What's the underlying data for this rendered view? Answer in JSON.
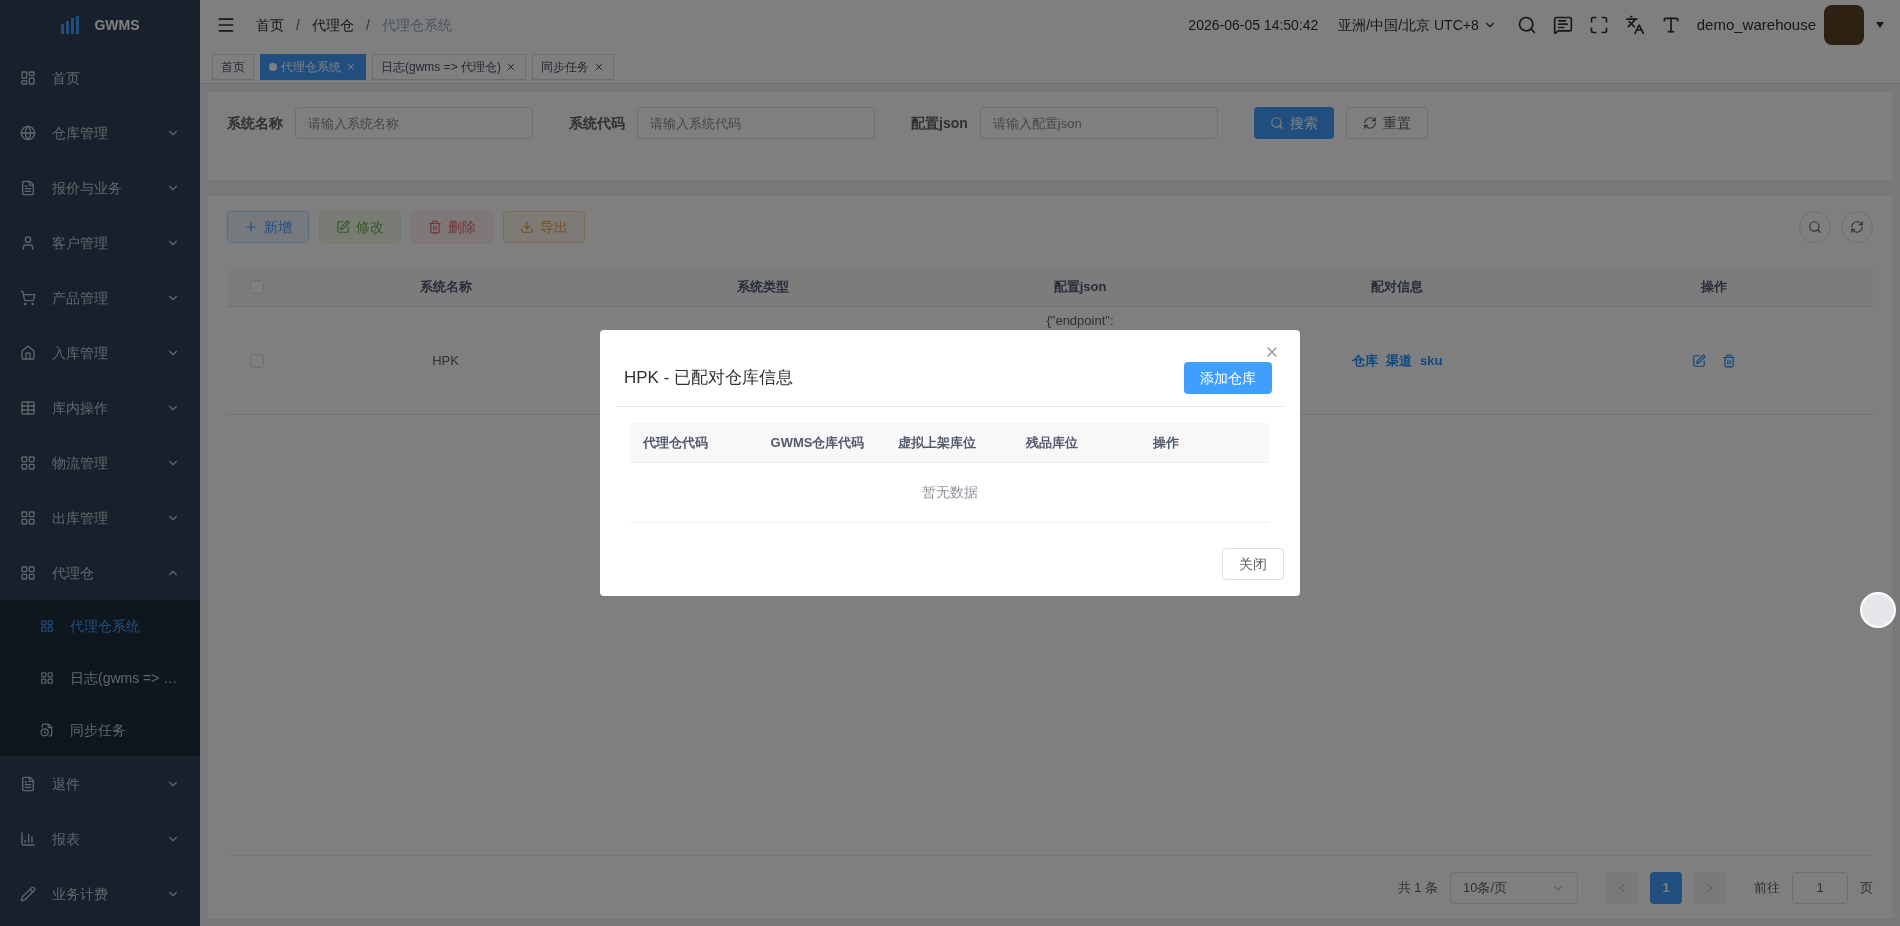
{
  "sidebar": {
    "logo": "GWMS",
    "items": [
      {
        "label": "首页"
      },
      {
        "label": "仓库管理",
        "expanded": false
      },
      {
        "label": "报价与业务",
        "expanded": false
      },
      {
        "label": "客户管理",
        "expanded": false
      },
      {
        "label": "产品管理",
        "expanded": false
      },
      {
        "label": "入库管理",
        "expanded": false
      },
      {
        "label": "库内操作",
        "expanded": false
      },
      {
        "label": "物流管理",
        "expanded": false
      },
      {
        "label": "出库管理",
        "expanded": false
      },
      {
        "label": "代理仓",
        "expanded": true,
        "children": [
          {
            "label": "代理仓系统",
            "selected": true
          },
          {
            "label": "日志(gwms => …",
            "selected": false
          },
          {
            "label": "同步任务",
            "selected": false
          }
        ]
      },
      {
        "label": "退件",
        "expanded": false
      },
      {
        "label": "报表",
        "expanded": false
      },
      {
        "label": "业务计费",
        "expanded": false
      }
    ]
  },
  "header": {
    "breadcrumb": [
      "首页",
      "代理仓",
      "代理仓系统"
    ],
    "breadcrumb_separator": "/",
    "datetime": "2026-06-05 14:50:42",
    "timezone": "亚洲/中国/北京 UTC+8",
    "username": "demo_warehouse"
  },
  "tags": [
    {
      "label": "首页",
      "selected": false,
      "closable": false
    },
    {
      "label": "代理仓系统",
      "selected": true,
      "closable": true
    },
    {
      "label": "日志(gwms => 代理仓)",
      "selected": false,
      "closable": true
    },
    {
      "label": "同步任务",
      "selected": false,
      "closable": true
    }
  ],
  "search_form": {
    "fields": [
      {
        "label": "系统名称",
        "placeholder": "请输入系统名称"
      },
      {
        "label": "系统代码",
        "placeholder": "请输入系统代码"
      },
      {
        "label": "配置json",
        "placeholder": "请输入配置json"
      }
    ],
    "search_button": "搜索",
    "reset_button": "重置"
  },
  "toolbar": [
    {
      "label": "新增",
      "kind": "primary",
      "disabled": false
    },
    {
      "label": "修改",
      "kind": "success",
      "disabled": true
    },
    {
      "label": "删除",
      "kind": "danger",
      "disabled": true
    },
    {
      "label": "导出",
      "kind": "warning",
      "disabled": false
    }
  ],
  "table": {
    "header_checked": false,
    "columns": [
      "系统名称",
      "系统类型",
      "配置json",
      "配对信息",
      "操作"
    ],
    "rows": [
      {
        "checked": false,
        "name": "HPK",
        "config_json": "{\"endpoint\":",
        "links": [
          "仓库",
          "渠道",
          "sku"
        ]
      }
    ]
  },
  "pagination": {
    "total": "共 1 条",
    "page_size": "10条/页",
    "pages": [
      {
        "label": "1",
        "selected": true
      }
    ],
    "goto_label": "前往",
    "goto_value": "1",
    "goto_suffix": "页"
  },
  "dialog": {
    "title": "HPK - 已配对仓库信息",
    "add_button": "添加仓库",
    "columns": [
      "代理仓代码",
      "GWMS仓库代码",
      "虚拟上架库位",
      "残品库位",
      "操作"
    ],
    "empty_text": "暂无数据",
    "close_button": "关闭"
  }
}
